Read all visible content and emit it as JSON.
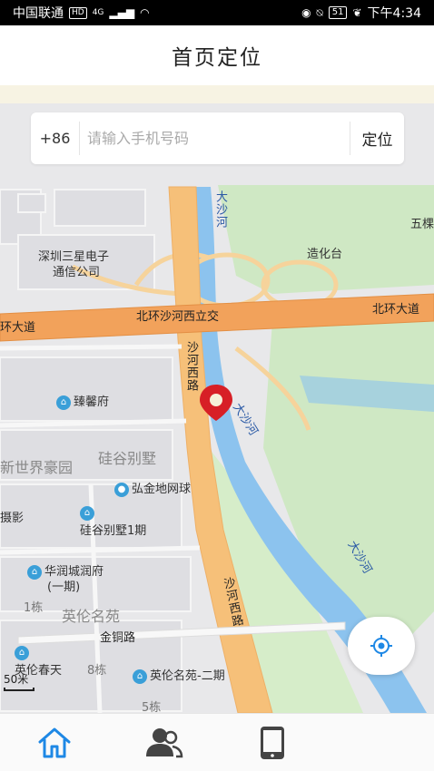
{
  "status_bar": {
    "carrier": "中国联通",
    "hd": "HD",
    "network": "4G",
    "battery": "51",
    "time": "下午4:34"
  },
  "header": {
    "title": "首页定位"
  },
  "phone_search": {
    "country_code": "+86",
    "placeholder": "请输入手机号码",
    "value": "",
    "button_label": "定位"
  },
  "map": {
    "labels": {
      "samsung": "深圳三星电子",
      "samsung2": "通信公司",
      "zaohuatai": "造化台",
      "wuke": "五棵",
      "road_bh_left": "环大道",
      "road_bh_right": "北环大道",
      "interchange": "北环沙河西立交",
      "shahe_river_top": "大沙河",
      "shahexilu_top": "沙河西路",
      "dashahe_mid": "大沙河",
      "dashahe_right": "大沙河",
      "jinxinfu": "臻馨府",
      "xinshijie": "新世界豪园",
      "guigu_vilas": "硅谷别墅",
      "hongjin": "弘金地网球",
      "sheying": "摄影",
      "guigu_1": "硅谷别墅1期",
      "huarun": "华润城润府",
      "huarun2": "(一期)",
      "shahexilu_bottom": "沙河西路",
      "building1": "1栋",
      "yinglun": "英伦名苑",
      "jintonglu": "金铜路",
      "yinglun_chuntian": "英伦春天",
      "building8": "8栋",
      "yinglun_2": "英伦名苑-二期",
      "building5": "5栋"
    },
    "scale": "50米"
  },
  "bottom_nav": {
    "items": [
      {
        "icon": "home-icon",
        "active": true
      },
      {
        "icon": "contacts-icon",
        "active": false
      },
      {
        "icon": "phone-device-icon",
        "active": false
      }
    ]
  },
  "colors": {
    "accent": "#1e88e5",
    "road_major": "#f6c079",
    "road_arterial": "#f2a25b",
    "river": "#8cc3ee",
    "park": "#cfe8c4",
    "pin": "#d71f26"
  }
}
